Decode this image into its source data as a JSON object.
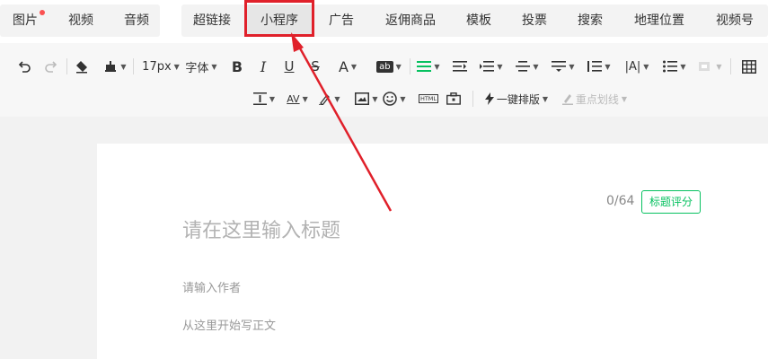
{
  "tabs_left": [
    {
      "label": "图片",
      "dot": true
    },
    {
      "label": "视频",
      "dot": false
    },
    {
      "label": "音频",
      "dot": false
    }
  ],
  "tabs_right": [
    {
      "label": "超链接"
    },
    {
      "label": "小程序",
      "active": true
    },
    {
      "label": "广告"
    },
    {
      "label": "返佣商品"
    },
    {
      "label": "模板"
    },
    {
      "label": "投票"
    },
    {
      "label": "搜索"
    },
    {
      "label": "地理位置"
    },
    {
      "label": "视频号"
    }
  ],
  "toolbar": {
    "font_size": "17px",
    "font_family": "字体",
    "text_bg_label": "ab",
    "html_label": "HTML",
    "one_click_layout": "一键排版",
    "key_underline": "重点划线"
  },
  "editor": {
    "counter": "0/64",
    "score_button": "标题评分",
    "title_placeholder": "请在这里输入标题",
    "author_placeholder": "请输入作者",
    "body_placeholder": "从这里开始写正文"
  },
  "colors": {
    "accent_green": "#07c160",
    "highlight_red": "#e0202a",
    "notify_dot": "#fa5151"
  }
}
